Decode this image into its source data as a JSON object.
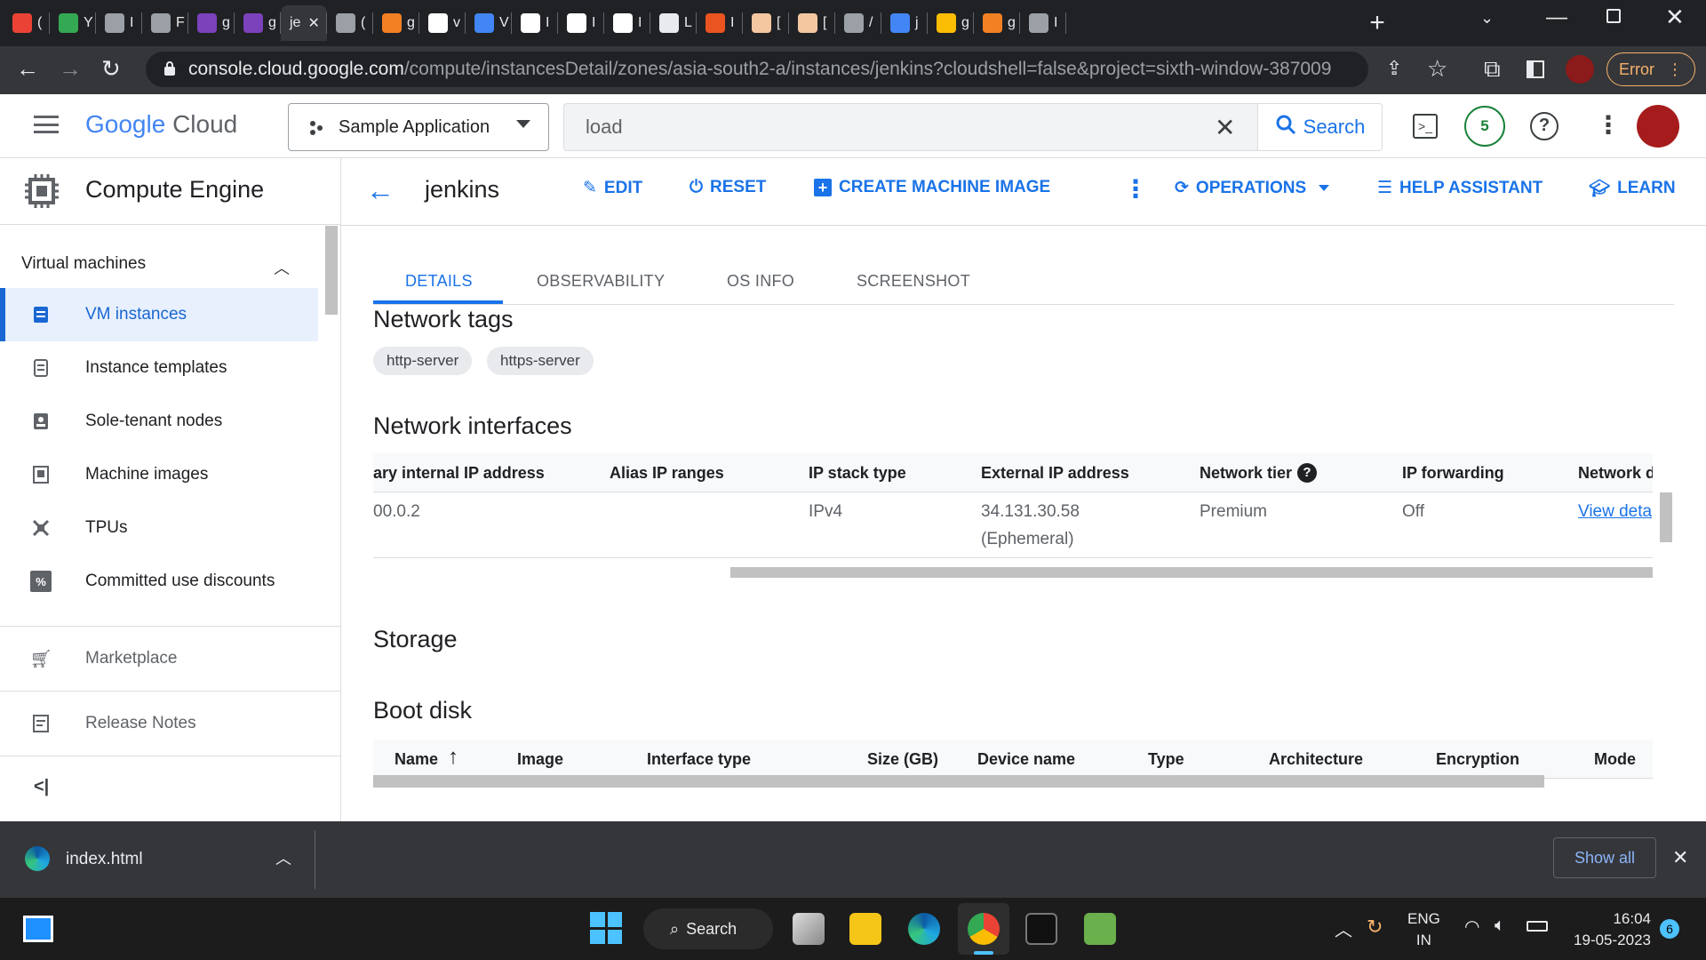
{
  "browser": {
    "tabs": [
      {
        "label": "(",
        "color": "#ea4335"
      },
      {
        "label": "Y",
        "color": "#34a853"
      },
      {
        "label": "I",
        "color": "#9aa0a6"
      },
      {
        "label": "F",
        "color": "#9aa0a6"
      },
      {
        "label": "g",
        "color": "#7b42bc"
      },
      {
        "label": "g",
        "color": "#7b42bc"
      },
      {
        "label": "je",
        "color": "#35363a"
      },
      {
        "label": "(",
        "color": "#9aa0a6"
      },
      {
        "label": "g",
        "color": "#f48024"
      },
      {
        "label": "v",
        "color": "#ffffff"
      },
      {
        "label": "V",
        "color": "#4285f4"
      },
      {
        "label": "I",
        "color": "#ffffff"
      },
      {
        "label": "I",
        "color": "#ffffff"
      },
      {
        "label": "I",
        "color": "#ffffff"
      },
      {
        "label": "L",
        "color": "#e8eaed"
      },
      {
        "label": "I",
        "color": "#e95420"
      },
      {
        "label": "[",
        "color": "#f4c7a1"
      },
      {
        "label": "[",
        "color": "#f4c7a1"
      },
      {
        "label": "/",
        "color": "#9aa0a6"
      },
      {
        "label": "j",
        "color": "#4285f4"
      },
      {
        "label": "g",
        "color": "#fbbc04"
      },
      {
        "label": "g",
        "color": "#f48024"
      },
      {
        "label": "I",
        "color": "#9aa0a6"
      }
    ],
    "url_host": "console.cloud.google.com",
    "url_path": "/compute/instancesDetail/zones/asia-south2-a/instances/jenkins?cloudshell=false&project=sixth-window-387009",
    "error_label": "Error"
  },
  "header": {
    "logo_google": "Google",
    "logo_cloud": "Cloud",
    "project": "Sample Application",
    "search_value": "load",
    "search_button": "Search",
    "notification_count": "5"
  },
  "sidebar": {
    "product": "Compute Engine",
    "section": "Virtual machines",
    "items": [
      {
        "label": "VM instances",
        "icon": "vm-icon"
      },
      {
        "label": "Instance templates",
        "icon": "template-icon"
      },
      {
        "label": "Sole-tenant nodes",
        "icon": "node-icon"
      },
      {
        "label": "Machine images",
        "icon": "image-icon"
      },
      {
        "label": "TPUs",
        "icon": "tpu-icon"
      },
      {
        "label": "Committed use discounts",
        "icon": "percent-icon"
      }
    ],
    "marketplace": "Marketplace",
    "release_notes": "Release Notes"
  },
  "instance": {
    "name": "jenkins",
    "actions": {
      "edit": "EDIT",
      "reset": "RESET",
      "create_image": "CREATE MACHINE IMAGE",
      "operations": "OPERATIONS",
      "help": "HELP ASSISTANT",
      "learn": "LEARN"
    },
    "tabs": [
      "DETAILS",
      "OBSERVABILITY",
      "OS INFO",
      "SCREENSHOT"
    ]
  },
  "network_tags": {
    "title": "Network tags",
    "tags": [
      "http-server",
      "https-server"
    ]
  },
  "network_interfaces": {
    "title": "Network interfaces",
    "headers": [
      "ary internal IP address",
      "Alias IP ranges",
      "IP stack type",
      "External IP address",
      "Network tier",
      "IP forwarding",
      "Network d"
    ],
    "row": {
      "internal_ip": "00.0.2",
      "alias": "",
      "stack": "IPv4",
      "external_ip": "34.131.30.58",
      "external_note": "(Ephemeral)",
      "tier": "Premium",
      "forwarding": "Off",
      "link": "View deta"
    }
  },
  "storage": {
    "title": "Storage",
    "boot_disk_title": "Boot disk",
    "headers": [
      "Name",
      "Image",
      "Interface type",
      "Size (GB)",
      "Device name",
      "Type",
      "Architecture",
      "Encryption",
      "Mode"
    ]
  },
  "downloads": {
    "file": "index.html",
    "show_all": "Show all"
  },
  "taskbar": {
    "search": "Search",
    "lang": "ENG",
    "region": "IN",
    "time": "16:04",
    "date": "19-05-2023",
    "badge": "6"
  }
}
